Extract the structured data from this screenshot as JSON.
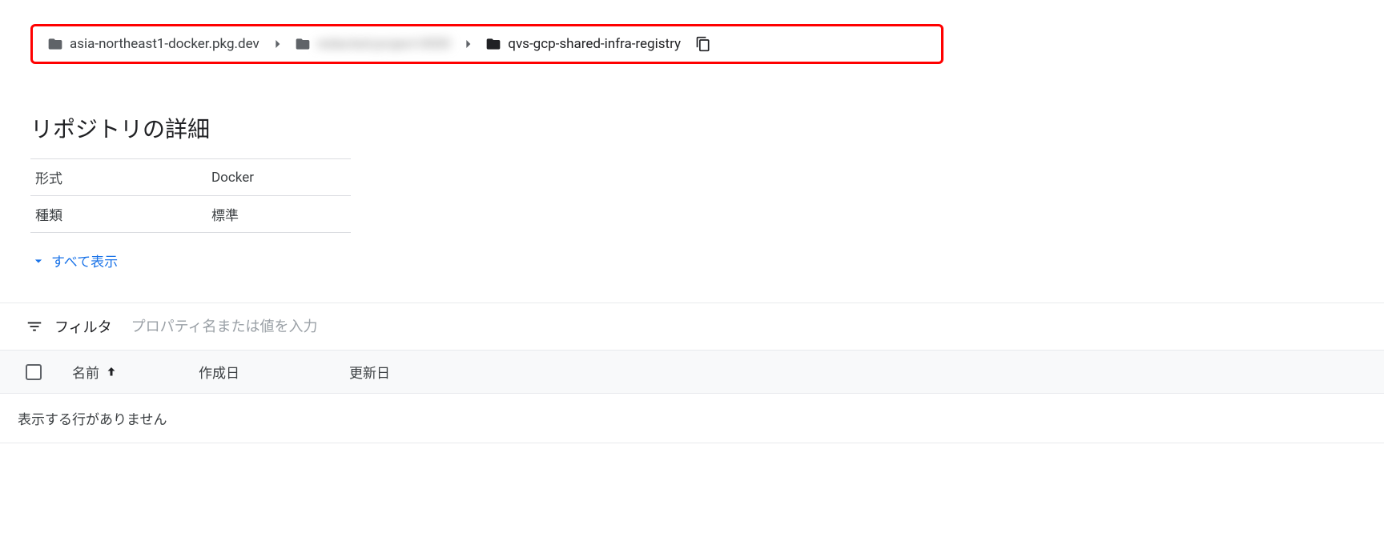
{
  "breadcrumb": {
    "items": [
      {
        "label": "asia-northeast1-docker.pkg.dev",
        "icon": "folder-grey"
      },
      {
        "label": "redacted-project-0000",
        "icon": "folder-grey",
        "blurred": true
      },
      {
        "label": "qvs-gcp-shared-infra-registry",
        "icon": "folder-black"
      }
    ]
  },
  "details": {
    "title": "リポジトリの詳細",
    "rows": [
      {
        "label": "形式",
        "value": "Docker"
      },
      {
        "label": "種類",
        "value": "標準"
      }
    ],
    "show_all": "すべて表示"
  },
  "filter": {
    "label": "フィルタ",
    "placeholder": "プロパティ名または値を入力"
  },
  "table": {
    "columns": {
      "name": "名前",
      "created": "作成日",
      "updated": "更新日"
    },
    "empty_message": "表示する行がありません"
  }
}
